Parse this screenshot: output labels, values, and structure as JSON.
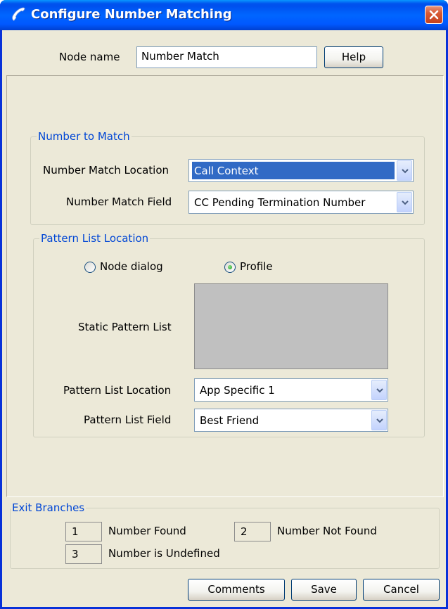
{
  "window": {
    "title": "Configure Number Matching",
    "icon": "phone-handset-icon",
    "close_icon": "close-icon"
  },
  "header": {
    "node_name_label": "Node name",
    "node_name_value": "Number Match",
    "help_label": "Help"
  },
  "number_to_match": {
    "legend": "Number to Match",
    "location_label": "Number Match Location",
    "location_value": "Call Context",
    "field_label": "Number Match Field",
    "field_value": "CC Pending Termination Number"
  },
  "pattern_list": {
    "legend": "Pattern List Location",
    "radio_node_dialog": "Node dialog",
    "radio_profile": "Profile",
    "selected_radio": "Profile",
    "static_label": "Static Pattern List",
    "location_label": "Pattern List Location",
    "location_value": "App Specific 1",
    "field_label": "Pattern List Field",
    "field_value": "Best Friend"
  },
  "exit_branches": {
    "legend": "Exit Branches",
    "items": [
      {
        "code": "1",
        "label": "Number Found"
      },
      {
        "code": "2",
        "label": "Number Not Found"
      },
      {
        "code": "3",
        "label": "Number is Undefined"
      }
    ]
  },
  "footer": {
    "comments_label": "Comments",
    "save_label": "Save",
    "cancel_label": "Cancel"
  },
  "colors": {
    "titlebar": "#0058ee",
    "legend_text": "#0046d5",
    "dialog_bg": "#ece9d8",
    "selection": "#316ac5"
  }
}
